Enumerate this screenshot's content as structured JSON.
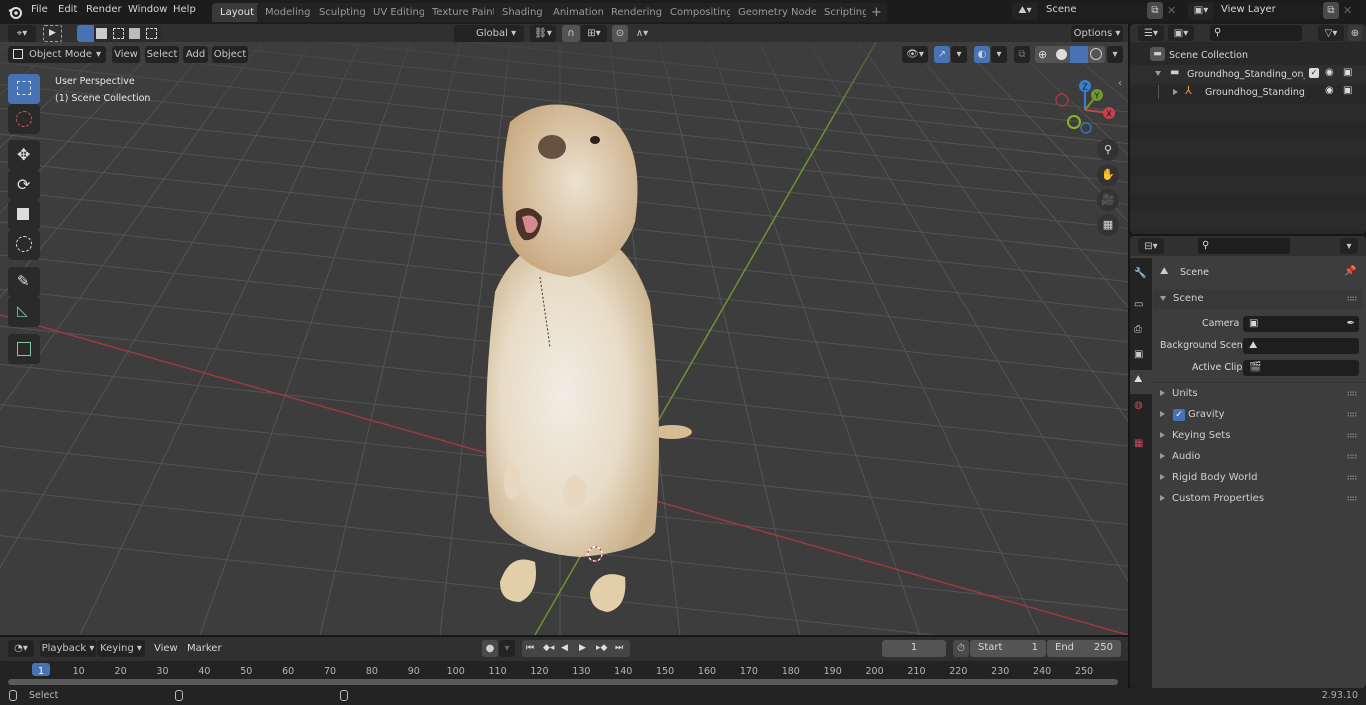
{
  "topbar": {
    "menus": [
      "File",
      "Edit",
      "Render",
      "Window",
      "Help"
    ],
    "workspace_tabs": [
      "Layout",
      "Modeling",
      "Sculpting",
      "UV Editing",
      "Texture Paint",
      "Shading",
      "Animation",
      "Rendering",
      "Compositing",
      "Geometry Nodes",
      "Scripting"
    ],
    "active_tab": "Layout",
    "add_tab": "+",
    "scene_field": "Scene",
    "view_layer_field": "View Layer"
  },
  "viewport": {
    "mode": "Object Mode",
    "menus": [
      "View",
      "Select",
      "Add",
      "Object"
    ],
    "transform_orientation": "Global",
    "options_label": "Options",
    "overlay_title": "User Perspective",
    "overlay_collection": "(1) Scene Collection",
    "gizmo_axes": {
      "x": "X",
      "y": "Y",
      "z": "Z"
    },
    "colors": {
      "x_axis": "#c8424d",
      "y_axis": "#6e9a2f",
      "z_axis": "#3b7fd4",
      "accent": "#4772b3"
    }
  },
  "tools": [
    "select-box",
    "cursor",
    "move",
    "rotate",
    "scale",
    "transform",
    "annotate",
    "measure",
    "add-cube"
  ],
  "outliner": {
    "root": "Scene Collection",
    "items": [
      {
        "label": "Groundhog_Standing_on_Hind",
        "type": "collection"
      },
      {
        "label": "Groundhog_Standing_on_",
        "type": "armature"
      }
    ]
  },
  "properties": {
    "context": "Scene",
    "section": "Scene",
    "fields": [
      {
        "label": "Camera",
        "value": ""
      },
      {
        "label": "Background Scene",
        "value": ""
      },
      {
        "label": "Active Clip",
        "value": ""
      }
    ],
    "panels": [
      "Units",
      "Gravity",
      "Keying Sets",
      "Audio",
      "Rigid Body World",
      "Custom Properties"
    ],
    "gravity_checked": true
  },
  "timeline": {
    "menus": [
      "Playback",
      "Keying",
      "View",
      "Marker"
    ],
    "current_frame": "1",
    "start_label": "Start",
    "start_value": "1",
    "end_label": "End",
    "end_value": "250",
    "ticks": [
      "1",
      "10",
      "20",
      "30",
      "40",
      "50",
      "60",
      "70",
      "80",
      "90",
      "100",
      "110",
      "120",
      "130",
      "140",
      "150",
      "160",
      "170",
      "180",
      "190",
      "200",
      "210",
      "220",
      "230",
      "240",
      "250"
    ]
  },
  "statusbar": {
    "select_label": "Select",
    "version": "2.93.10"
  }
}
